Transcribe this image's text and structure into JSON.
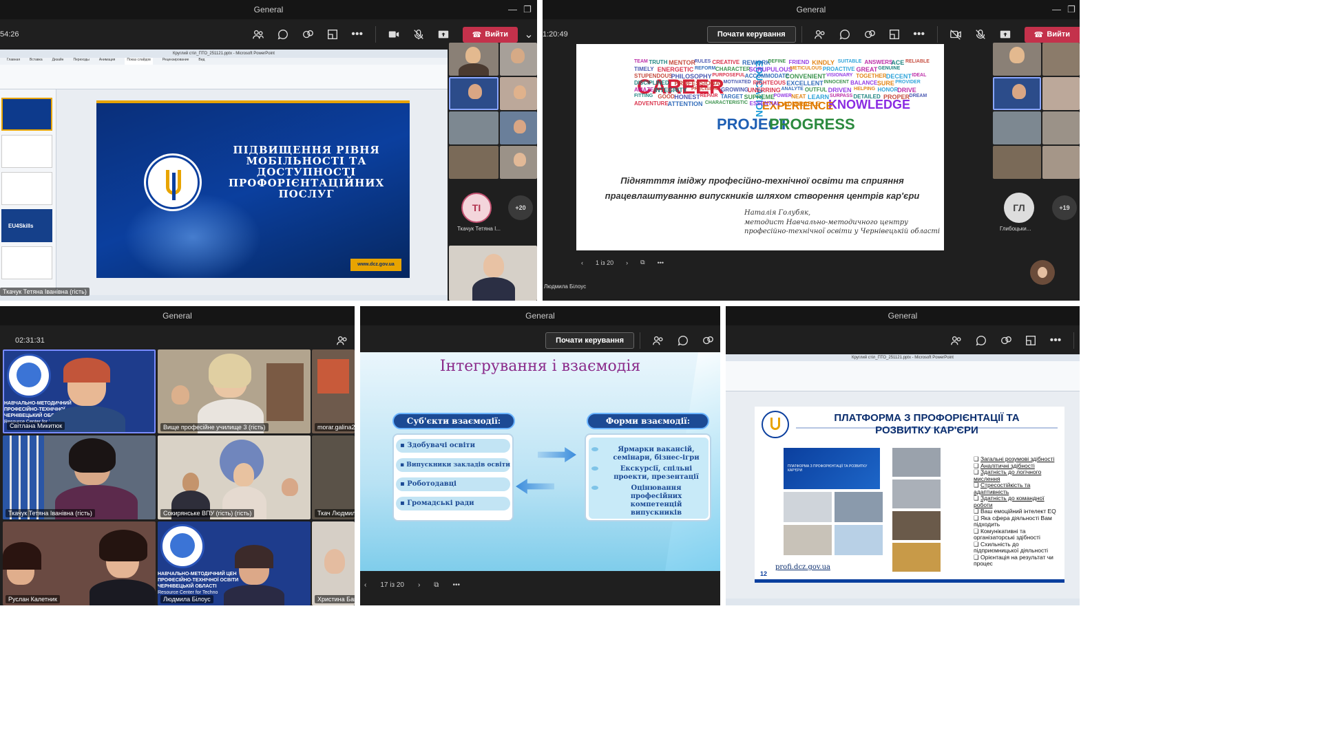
{
  "p1": {
    "title": "General",
    "timer": "54:26",
    "leave": "Вийти",
    "ppt_title": "Круглий стіл_ПТО_251121.pptx - Microsoft PowerPoint",
    "ribbon_tabs": [
      "Главная",
      "Вставка",
      "Дизайн",
      "Переходы",
      "Анимация",
      "Показ слайдов",
      "Рецензирование",
      "Вид"
    ],
    "slide_lines": [
      "ПІДВИЩЕННЯ РІВНЯ",
      "МОБІЛЬНОСТІ ТА",
      "ДОСТУПНОСТІ",
      "ПРОФОРІЄНТАЦІЙНИХ",
      "ПОСЛУГ"
    ],
    "logo_text": "ДЕРЖАВНА СЛУЖБА ЗАЙНЯТОСТІ",
    "url": "www.dcz.gov.ua",
    "thumb_label": "EU4Skills",
    "presenter": "Ткачук Тетяна Іванівна (гість)",
    "avatar_initials": "ТІ",
    "avatar_name": "Ткачук Тетяна І...",
    "more": "+20"
  },
  "p2": {
    "title": "General",
    "timer": "1:20:49",
    "control": "Почати керування",
    "leave": "Вийти",
    "words": [
      "CAREER",
      "PROJECT",
      "PROGRESS",
      "KNOWLEDGE",
      "EXPERIENCE",
      "EDUCATION",
      "TEAM",
      "TRUTH",
      "MENTOR",
      "RULES",
      "CREATIVE",
      "REWORK",
      "DEFINE",
      "FRIEND",
      "KINDLY",
      "SUITABLE",
      "ANSWERS",
      "ACE",
      "RELIABLE",
      "TIMELY",
      "ENERGETIC",
      "REFORM",
      "CHARACTER",
      "SCRUPULOUS",
      "METICULOUS",
      "PROACTIVE",
      "GREAT",
      "GENUINE",
      "STUPENDOUS",
      "PHILOSOPHY",
      "PURPOSEFUL",
      "ACCOMMODATE",
      "CONVENIENT",
      "VISIONARY",
      "TOGETHER",
      "DECENT",
      "IDEAL",
      "DISCIPLINED",
      "PROFESSIONAL",
      "MOTIVATED",
      "RIGHTEOUS",
      "EXCELLENT",
      "INNOCENT",
      "BALANCE",
      "SURE",
      "PROVIDER",
      "AMAZE",
      "INTEGRITY",
      "PRECISION",
      "GROWING",
      "UNERRING",
      "ANALYTE",
      "OUTFUL",
      "DRIVEN",
      "HELPING",
      "HONOR",
      "DRIVE",
      "FITTING",
      "GOOD",
      "HONEST",
      "REPAIR",
      "TARGET",
      "SUPREME",
      "POWER",
      "NEAT",
      "LEARN",
      "SURPASS",
      "DETAILED",
      "PROPER",
      "DREAM",
      "ADVENTURE",
      "ATTENTION",
      "CHARACTERISTIC",
      "ESSENTIAL",
      "ADMIRABLE"
    ],
    "slide_title": "Піднятття іміджу професійно-технічної освіти та сприяння працевлаштуванню випускників шляхом створення центрів кар'єри",
    "author": "Наталія Голубяк,",
    "author_role": "методист Навчально-методичного центру професійно-технічної освіти у Чернівецькій області",
    "pager": "1 із 20",
    "avatar_initials": "ГЛ",
    "avatar_name": "Глибоцьки...",
    "more": "+19",
    "presenter": "Людмила Білоус"
  },
  "p3": {
    "title": "General",
    "timer": "02:31:31",
    "logo_lines": [
      "НАВЧАЛЬНО-МЕТОДИЧНИЙ",
      "ПРОФЕСІЙНО-ТЕХНІЧНОЇ",
      "ЧЕРНІВЕЦЬКИЙ ОБЛАСТІ",
      "Resource Center for Techn"
    ],
    "logo_lines_b": [
      "НАВЧАЛЬНО-МЕТОДИЧНИЙ ЦЕН",
      "ПРОФЕСІЙНО-ТЕХНІЧНОЇ ОСВІТИ",
      "ЧЕРНІВЕЦЬКІЙ ОБЛАСТІ",
      "Resource Center for Techno"
    ],
    "tiles": [
      "Світлана Микитюк",
      "Вище професійне училище 3 (гість)",
      "morar.galina2012",
      "Ткачук Тетяна Іванівна (гість)",
      "Сокирянське ВПУ (гість) (гість)",
      "Ткач Людмила",
      "Руслан Калетник",
      "Людмила Білоус",
      "Христина Багрі"
    ]
  },
  "p4": {
    "title": "General",
    "control": "Почати керування",
    "slide_title": "Інтегрування і взаємодія",
    "left_head": "Суб'єкти взаємодії:",
    "left_items": [
      "Здобувачі освіти",
      "Випускники закладів освіти",
      "Роботодавці",
      "Громадські ради"
    ],
    "right_head": "Форми взаємодії:",
    "right_items": [
      "Ярмарки вакансій, семінари, бізнес-ігри",
      "Екскурсії, спільні проекти, презентації",
      "Оцінювання професійних компетенцій випускників"
    ],
    "pager": "17 із 20"
  },
  "p5": {
    "title": "General",
    "ppt_title": "Круглий стіл_ПТО_251121.pptx - Microsoft PowerPoint",
    "slide_title_1": "ПЛАТФОРМА З ПРОФОРІЄНТАЦІЇ ТА",
    "slide_title_2": "РОЗВИТКУ КАР'ЄРИ",
    "shot_caption": "ПЛАТФОРМА З ПРОФОРІЄНТАЦІЇ ТА РОЗВИТКУ КАР'ЄРИ",
    "list": [
      "Загальні розумові здібності",
      "Аналітичні здібності",
      "Здатність до логічного мислення",
      "Стресостійкість та адаптивність",
      "Здатність до командної роботи",
      "Ваш емоційний інтелект EQ",
      "Яка сфера діяльності Вам підходить",
      "Комунікативні та організаторські здібності",
      "Схильність до підприємницької діяльності",
      "Орієнтація на результат чи процес"
    ],
    "link": "profi.dcz.gov.ua",
    "page_num": "12"
  }
}
